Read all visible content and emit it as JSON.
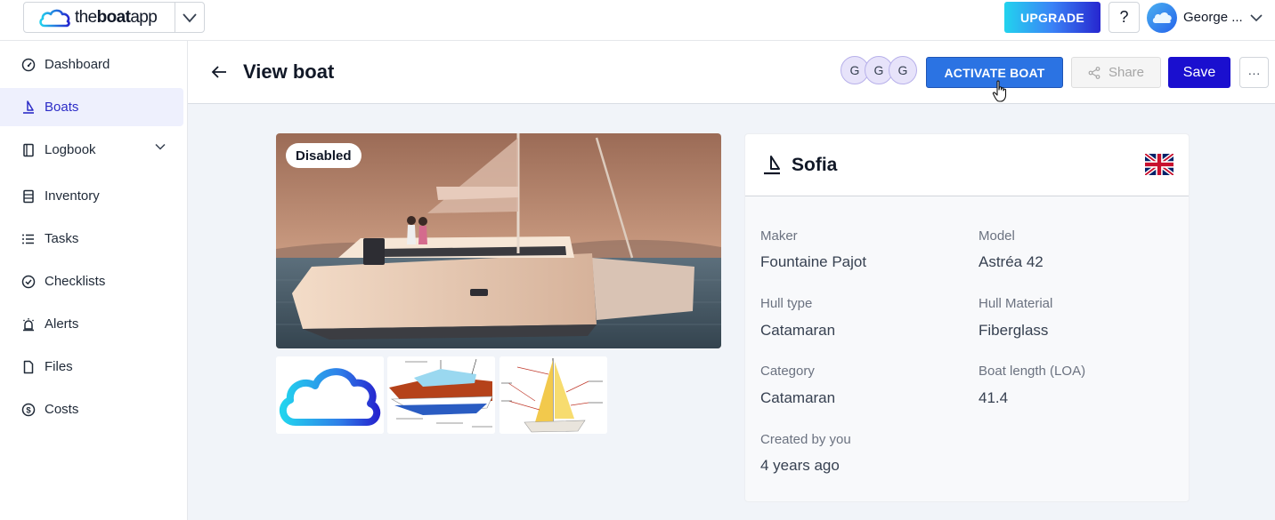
{
  "brand": {
    "name_light": "the",
    "name_bold": "boat",
    "name_light2": "app"
  },
  "topbar": {
    "upgrade_label": "UPGRADE",
    "help_label": "?",
    "user_name": "George ..."
  },
  "sidebar": {
    "items": [
      {
        "label": "Dashboard",
        "icon": "gauge-icon"
      },
      {
        "label": "Boats",
        "icon": "sailboat-icon",
        "active": true
      },
      {
        "label": "Logbook",
        "icon": "book-icon",
        "expandable": true
      },
      {
        "label": "Inventory",
        "icon": "cabinet-icon"
      },
      {
        "label": "Tasks",
        "icon": "list-icon"
      },
      {
        "label": "Checklists",
        "icon": "check-circle-icon"
      },
      {
        "label": "Alerts",
        "icon": "alarm-icon"
      },
      {
        "label": "Files",
        "icon": "file-icon"
      },
      {
        "label": "Costs",
        "icon": "dollar-circle-icon"
      }
    ]
  },
  "header": {
    "title": "View boat",
    "avatars": [
      "G",
      "G",
      "G"
    ],
    "activate_label": "ACTIVATE BOAT",
    "share_label": "Share",
    "save_label": "Save",
    "more_label": "···"
  },
  "gallery": {
    "status_badge": "Disabled"
  },
  "boat": {
    "name": "Sofia",
    "flag": "uk-flag-icon",
    "fields": {
      "maker_label": "Maker",
      "maker": "Fountaine Pajot",
      "model_label": "Model",
      "model": "Astréa 42",
      "hull_type_label": "Hull type",
      "hull_type": "Catamaran",
      "hull_material_label": "Hull Material",
      "hull_material": "Fiberglass",
      "category_label": "Category",
      "category": "Catamaran",
      "length_label": "Boat length (LOA)",
      "length": "41.4",
      "created_label": "Created by you",
      "created": "4 years ago"
    }
  },
  "colors": {
    "accent": "#1a0fcf",
    "activate": "#2b73e3",
    "active_nav_bg": "#eef0fd",
    "active_nav_text": "#2c2cc7"
  }
}
